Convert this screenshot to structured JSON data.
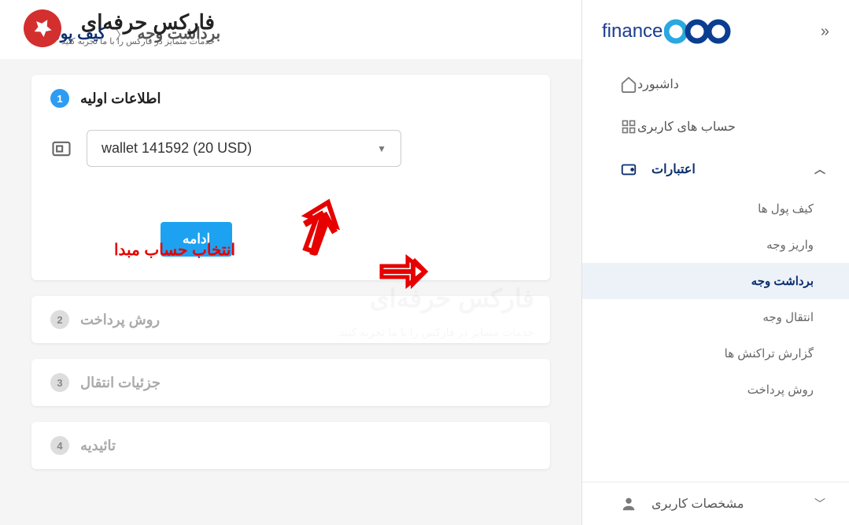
{
  "brand": {
    "name": "opo",
    "suffix": "finance"
  },
  "sidebar": {
    "items": [
      {
        "label": "داشبورد",
        "icon": "home"
      },
      {
        "label": "حساب های کاربری",
        "icon": "grid"
      },
      {
        "label": "اعتبارات",
        "icon": "wallet",
        "active": true,
        "expanded": true
      },
      {
        "label": "مشخصات کاربری",
        "icon": "user",
        "bottom": true
      }
    ],
    "credits_submenu": [
      {
        "label": "کیف پول ها"
      },
      {
        "label": "واریز وجه"
      },
      {
        "label": "برداشت وجه",
        "active": true
      },
      {
        "label": "انتقال وجه"
      },
      {
        "label": "گزارش تراکنش ها"
      },
      {
        "label": "روش پرداخت"
      }
    ]
  },
  "breadcrumb": {
    "parent": "کیف پول ها",
    "current": "برداشت وجه"
  },
  "steps": [
    {
      "number": "1",
      "title": "اطلاعات اولیه",
      "active": true
    },
    {
      "number": "2",
      "title": "روش پرداخت",
      "active": false
    },
    {
      "number": "3",
      "title": "جزئیات انتقال",
      "active": false
    },
    {
      "number": "4",
      "title": "تائیدیه",
      "active": false
    }
  ],
  "form": {
    "wallet_selected": "wallet 141592 (20 USD)",
    "continue_label": "ادامه"
  },
  "annotations": {
    "select_account": "انتخاب حساب مبدا"
  },
  "overlay": {
    "title": "فارکس حرفه‌ای",
    "subtitle": "خدمات متمایز در فارکس را با ما تجربه کنید"
  }
}
